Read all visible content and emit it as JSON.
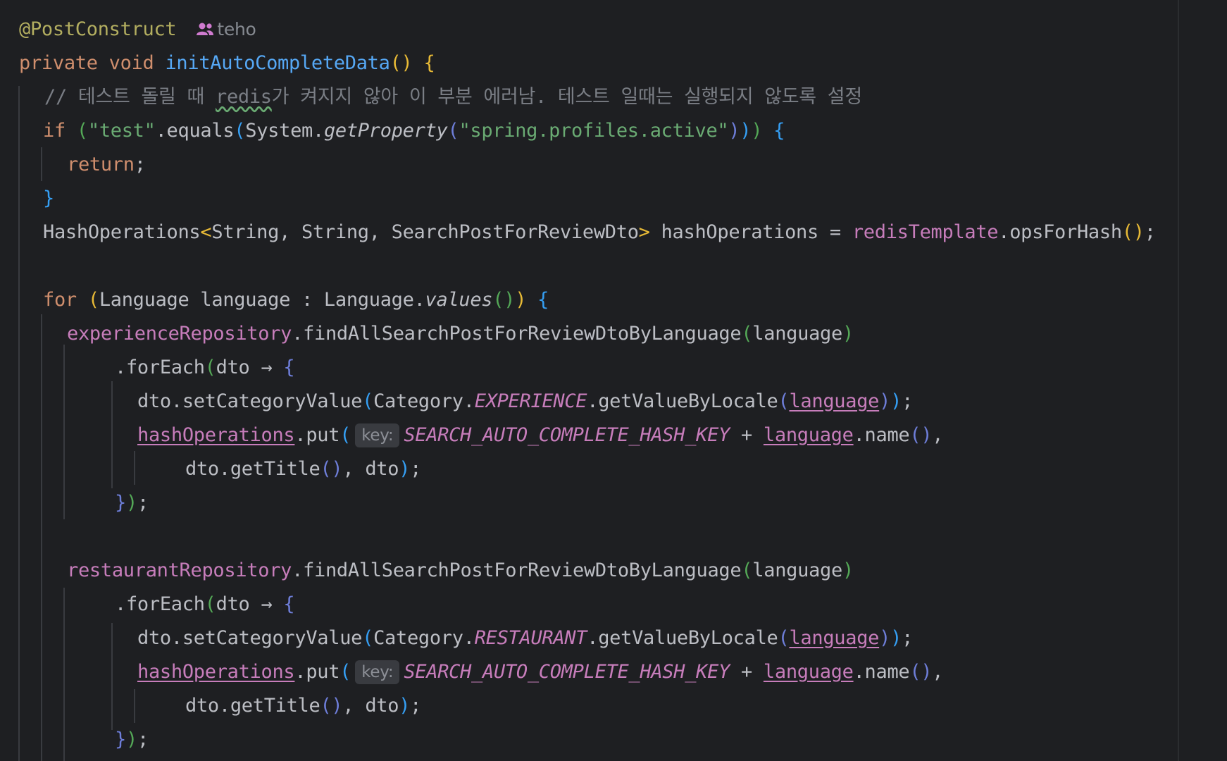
{
  "author_hint": {
    "icon": "people-icon",
    "name": "teho",
    "icon_color": "#d07bd0"
  },
  "param_hint_label": "key:",
  "colors": {
    "background": "#1e1f22",
    "keyword": "#cf8e6d",
    "annotation": "#b3ae60",
    "function": "#56a8f5",
    "string": "#6aab73",
    "comment": "#7a7e85",
    "field": "#c77dbb",
    "text": "#bcbec4"
  },
  "code": {
    "annotation": "@PostConstruct",
    "kw_private": "private",
    "kw_void": "void",
    "method_name": "initAutoCompleteData",
    "comment": "// 테스트 돌릴 때 redis가 켜지지 않아 이 부분 에러남. 테스트 일때는 실행되지 않도록 설정",
    "kw_if": "if",
    "str_test": "\"test\"",
    "equals": ".equals",
    "system": "System.",
    "get_property": "getProperty",
    "str_profile": "\"spring.profiles.active\"",
    "kw_return": "return",
    "hash_ops_type": "HashOperations",
    "type_args": "String, String, SearchPostForReviewDto",
    "hash_ops_var": " hashOperations = ",
    "redis_template": "redisTemplate",
    "ops_for_hash": ".opsForHash",
    "kw_for": "for",
    "loop_var": "Language language : Language.",
    "values": "values",
    "experience_repository": "experienceRepository",
    "restaurant_repository": "restaurantRepository",
    "find_method": ".findAllSearchPostForReviewDtoByLanguage",
    "language": "language",
    "for_each": ".forEach",
    "lambda_head": "dto → ",
    "set_category": "dto.setCategoryValue",
    "category": "Category.",
    "experience": "EXPERIENCE",
    "restaurant": "RESTAURANT",
    "get_value_by_locale": ".getValueByLocale",
    "hash_operations": "hashOperations",
    "put": ".put",
    "hash_key": "SEARCH_AUTO_COMPLETE_HASH_KEY",
    "plus": " + ",
    "name": ".name",
    "get_title": "dto.getTitle",
    "dto": "dto"
  }
}
